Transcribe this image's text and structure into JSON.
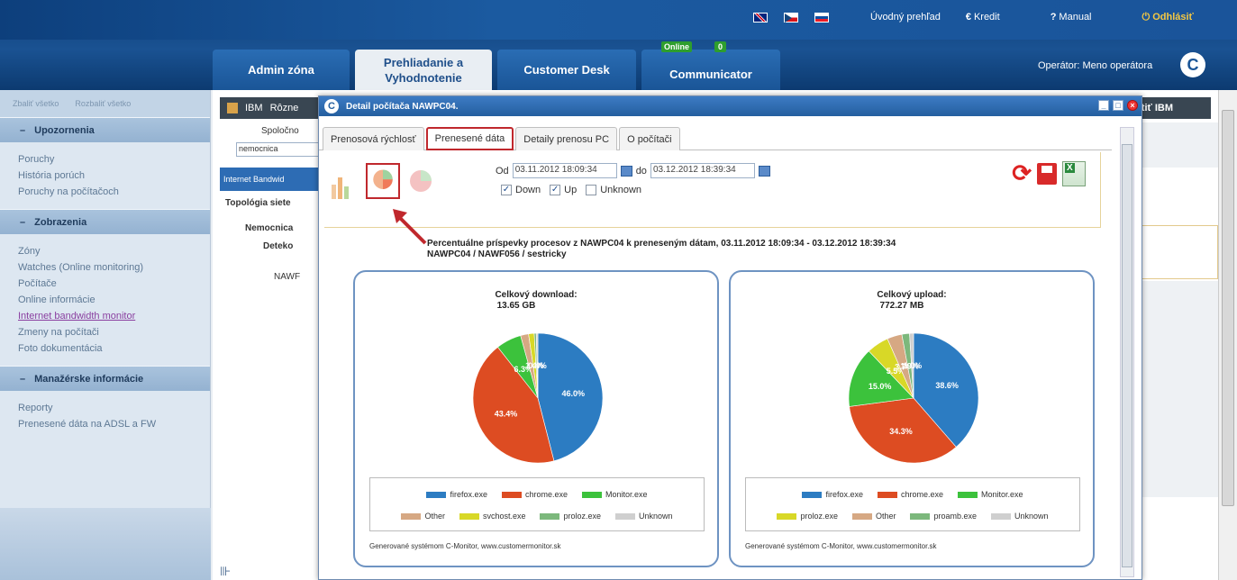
{
  "header": {
    "links": {
      "overview": "Úvodný prehľad",
      "credit": "Kredit",
      "manual": "Manual",
      "logout": "Odhlásiť"
    },
    "tabs": {
      "admin": "Admin zóna",
      "browse_line1": "Prehliadanie a",
      "browse_line2": "Vyhodnotenie",
      "customer_desk": "Customer Desk",
      "communicator": "Communicator",
      "online_label": "Online",
      "online_count": "0"
    },
    "operator": "Operátor: Meno operátora"
  },
  "sidebar": {
    "collapse_all": "Zbaliť všetko",
    "expand_all": "Rozbaliť všetko",
    "sections": {
      "alerts": "Upozornenia",
      "views": "Zobrazenia",
      "mgmt": "Manažérske informácie"
    },
    "alerts_items": [
      "Poruchy",
      "História porúch",
      "Poruchy na počítačoch"
    ],
    "views_items": [
      "Zóny",
      "Watches (Online monitoring)",
      "Počítače",
      "Online informácie",
      "Internet bandwidth monitor",
      "Zmeny na počítači",
      "Foto dokumentácia"
    ],
    "mgmt_items": [
      "Reporty",
      "Prenesené dáta na ADSL a FW"
    ]
  },
  "background": {
    "bar_ibm": "IBM",
    "bar_other": "Rôzne",
    "bar_start": "pustiť IBM",
    "company_label": "Spoločno",
    "company_value": "nemocnica",
    "internet_bw": "Internet Bandwid",
    "topology": "Topológia siete",
    "node_hospital": "Nemocnica",
    "node_detect": "Deteko",
    "node_pc": "NAWF"
  },
  "modal": {
    "title": "Detail počítača NAWPC04.",
    "tabs": [
      "Prenosová rýchlosť",
      "Prenesené dáta",
      "Detaily prenosu PC",
      "O počítači"
    ],
    "date_from_label": "Od",
    "date_from": "03.11.2012 18:09:34",
    "date_to_label": "do",
    "date_to": "03.12.2012 18:39:34",
    "checks": {
      "down": "Down",
      "up": "Up",
      "unknown": "Unknown"
    },
    "chart_title_line1": "Percentuálne príspevky procesov z NAWPC04 k preneseným dátam, 03.11.2012 18:09:34 - 03.12.2012 18:39:34",
    "chart_title_line2": "NAWPC04 / NAWF056 / sestricky",
    "generated": "Generované systémom C-Monitor, www.customermonitor.sk"
  },
  "chart_data": [
    {
      "type": "pie",
      "title": "Celkový download:",
      "subtitle": "13.65 GB",
      "labels": [
        "firefox.exe",
        "chrome.exe",
        "Monitor.exe",
        "Other",
        "svchost.exe",
        "proloz.exe",
        "Unknown"
      ],
      "values": [
        46.0,
        43.4,
        6.3,
        2.0,
        1.4,
        0.5,
        0.4
      ],
      "colors": [
        "#2c7cc2",
        "#dd4c22",
        "#3cc23c",
        "#d6a883",
        "#d8d827",
        "#7cb87c",
        "#cfcfcf"
      ],
      "shown_labels": [
        "46.0%",
        "43.4%",
        "6.3%",
        "1.4%",
        "0.4%"
      ]
    },
    {
      "type": "pie",
      "title": "Celkový upload:",
      "subtitle": "772.27 MB",
      "labels": [
        "firefox.exe",
        "chrome.exe",
        "Monitor.exe",
        "proloz.exe",
        "Other",
        "proamb.exe",
        "Unknown"
      ],
      "values": [
        38.6,
        34.3,
        15.0,
        5.5,
        3.7,
        1.9,
        1.0
      ],
      "colors": [
        "#2c7cc2",
        "#dd4c22",
        "#3cc23c",
        "#d8d827",
        "#d6a883",
        "#7cb87c",
        "#cfcfcf"
      ],
      "shown_labels": [
        "38.6%",
        "34.3%",
        "15.0%",
        "5.5%",
        "3.7%",
        "1.9%",
        "1.0%"
      ]
    }
  ]
}
